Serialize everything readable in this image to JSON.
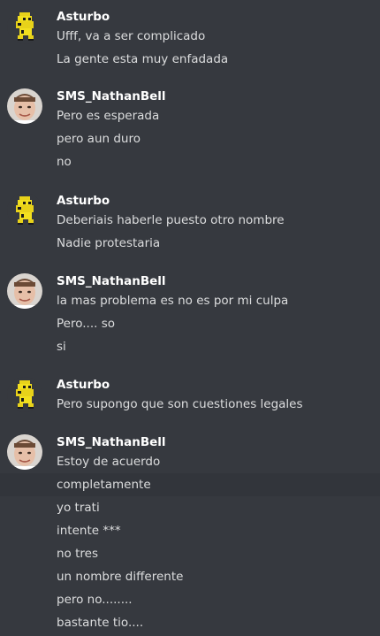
{
  "colors": {
    "background": "#36393f",
    "hover_row": "#32353b",
    "author": "#ffffff",
    "message": "#dcddde"
  },
  "groups": [
    {
      "author": "Asturbo",
      "avatar_icon": "yellow-pixel-character-icon",
      "lines": [
        "Ufff, va a ser complicado",
        "La gente esta muy enfadada"
      ]
    },
    {
      "author": "SMS_NathanBell",
      "avatar_icon": "user-photo-avatar",
      "lines": [
        "Pero es esperada",
        "pero aun duro",
        "no"
      ]
    },
    {
      "author": "Asturbo",
      "avatar_icon": "yellow-pixel-character-icon",
      "lines": [
        "Deberiais haberle puesto otro nombre",
        "Nadie protestaria"
      ]
    },
    {
      "author": "SMS_NathanBell",
      "avatar_icon": "user-photo-avatar",
      "lines": [
        "la mas problema es no es por mi culpa",
        "Pero.... so",
        "si"
      ]
    },
    {
      "author": "Asturbo",
      "avatar_icon": "yellow-pixel-character-icon",
      "lines": [
        "Pero supongo que son cuestiones legales"
      ]
    },
    {
      "author": "SMS_NathanBell",
      "avatar_icon": "user-photo-avatar",
      "lines": [
        "Estoy de acuerdo",
        "completamente",
        "yo trati",
        "intente ***",
        "no tres",
        "un nombre differente",
        "pero no........",
        "bastante tio...."
      ]
    }
  ]
}
